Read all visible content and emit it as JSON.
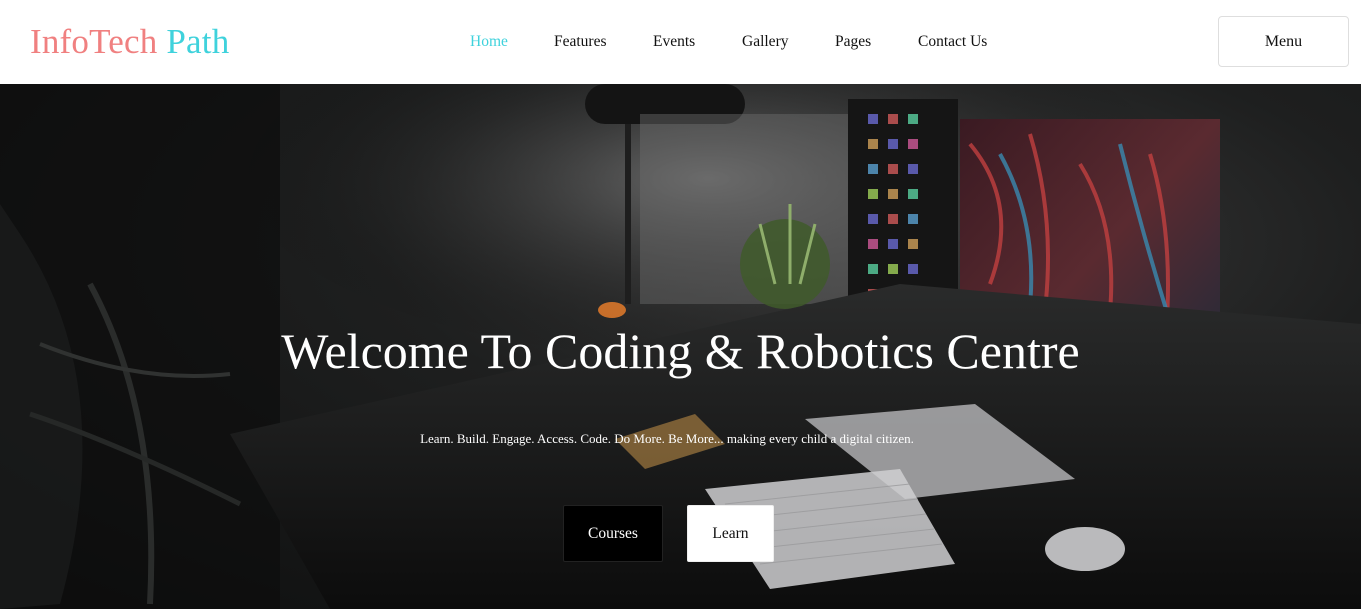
{
  "brand": {
    "name_part1": "InfoTech",
    "name_part2": "Path"
  },
  "nav": {
    "items": [
      {
        "label": "Home",
        "active": true
      },
      {
        "label": "Features",
        "active": false
      },
      {
        "label": "Events",
        "active": false
      },
      {
        "label": "Gallery",
        "active": false
      },
      {
        "label": "Pages",
        "active": false
      },
      {
        "label": "Contact Us",
        "active": false
      }
    ],
    "menu_label": "Menu"
  },
  "hero": {
    "title": "Welcome To Coding & Robotics Centre",
    "subtitle": "Learn. Build. Engage. Access. Code. Do More. Be More... making every child a digital citizen.",
    "primary_button": "Courses",
    "secondary_button": "Learn"
  },
  "colors": {
    "brand_pink": "#f08080",
    "brand_cyan": "#3fd2dc",
    "active_nav": "#3fd2dc",
    "hero_bg": "#121313"
  }
}
